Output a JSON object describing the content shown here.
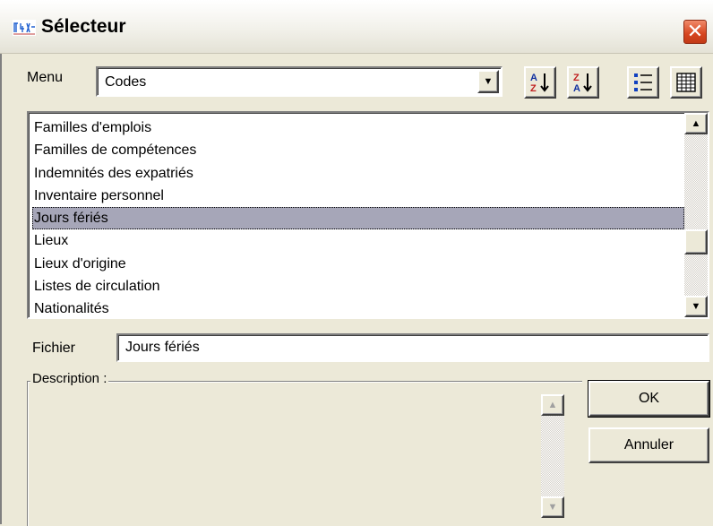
{
  "window": {
    "title": "Sélecteur",
    "close_label": "✕"
  },
  "menu": {
    "label": "Menu",
    "selected_value": "Codes"
  },
  "toolbar": {
    "icons": [
      "sort-ascending-icon",
      "sort-descending-icon",
      "list-view-icon",
      "detail-view-icon"
    ]
  },
  "list": {
    "items": [
      "Familles d'emplois",
      "Familles de compétences",
      "Indemnités des expatriés",
      "Inventaire personnel",
      "Jours fériés",
      "Lieux",
      "Lieux d'origine",
      "Listes de circulation",
      "Nationalités"
    ],
    "selected_index": 4
  },
  "fichier": {
    "label": "Fichier",
    "value": "Jours fériés"
  },
  "description": {
    "label": "Description :"
  },
  "buttons": {
    "ok": "OK",
    "cancel": "Annuler"
  }
}
